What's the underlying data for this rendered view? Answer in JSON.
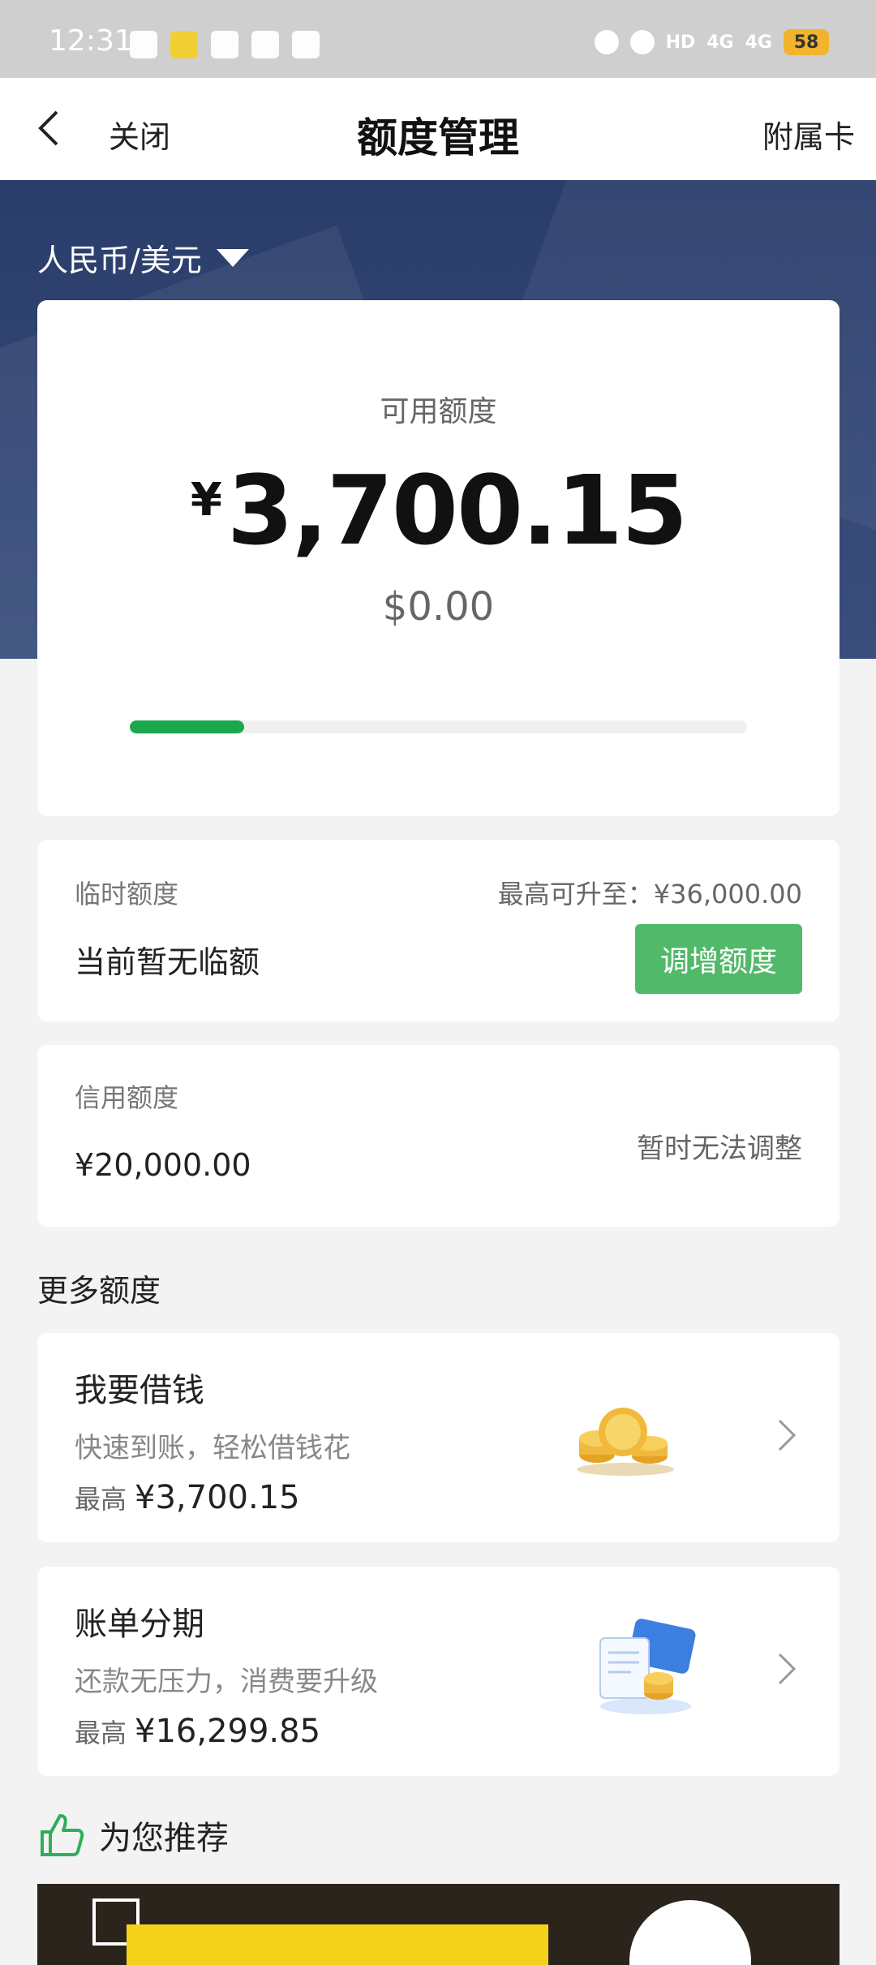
{
  "status_bar": {
    "time": "12:31",
    "signal_1": "4G",
    "signal_2": "4G",
    "battery": "58"
  },
  "nav": {
    "close": "关闭",
    "title": "额度管理",
    "supplementary_card": "附属卡"
  },
  "currency_selector": {
    "label": "人民币/美元"
  },
  "main_card": {
    "available_label": "可用额度",
    "yen_symbol": "¥",
    "available_amount": "3,700.15",
    "usd_amount": "$0.00",
    "progress_fraction": 0.185
  },
  "temp_limit": {
    "label": "临时额度",
    "max_text": "最高可升至：¥36,000.00",
    "status": "当前暂无临额",
    "button": "调增额度"
  },
  "credit_limit": {
    "label": "信用额度",
    "value": "¥20,000.00",
    "note": "暂时无法调整"
  },
  "more": {
    "title": "更多额度",
    "items": [
      {
        "title": "我要借钱",
        "subtitle": "快速到账，轻松借钱花",
        "max_label": "最高",
        "max_amount": "¥3,700.15",
        "icon": "coins-icon"
      },
      {
        "title": "账单分期",
        "subtitle": "还款无压力，消费要升级",
        "max_label": "最高",
        "max_amount": "¥16,299.85",
        "icon": "bill-installment-icon"
      }
    ]
  },
  "recommend": {
    "title": "为您推荐",
    "icon": "thumbs-up-icon"
  },
  "colors": {
    "hero": "#2a3d6a",
    "accent_green": "#1aa84f",
    "button_green": "#52b96a"
  }
}
